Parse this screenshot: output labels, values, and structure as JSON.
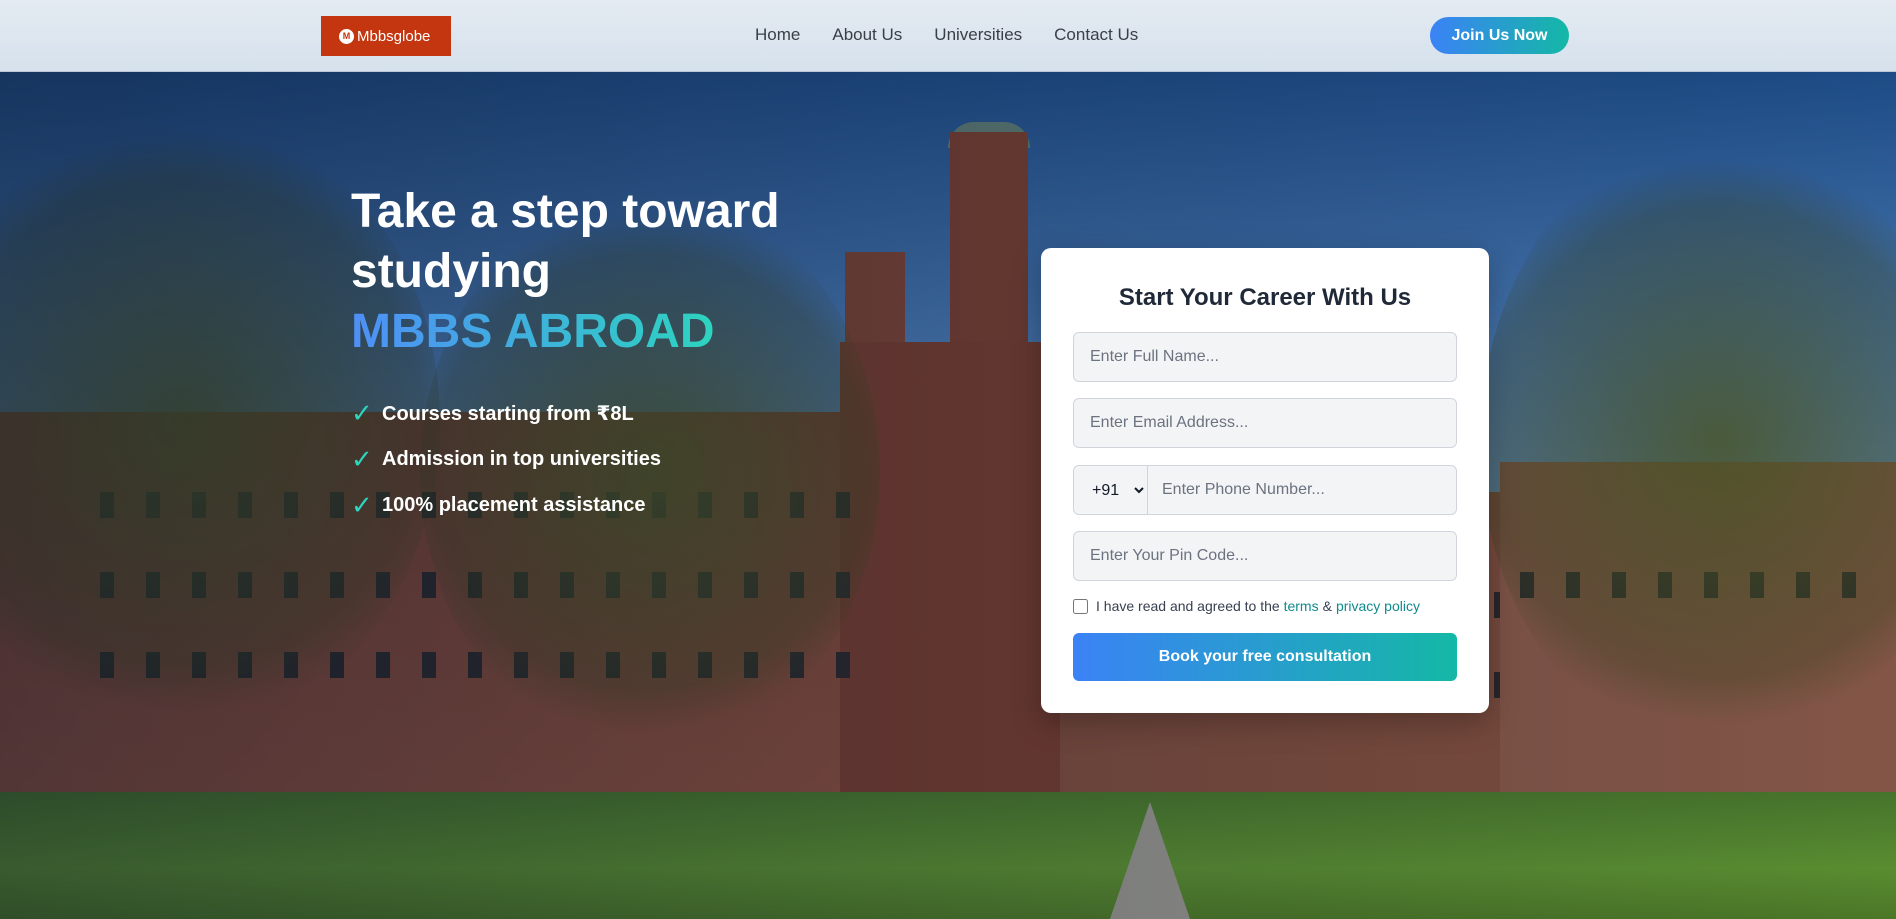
{
  "header": {
    "logo_text": "Mbbsglobe",
    "logo_mark": "M",
    "nav": [
      {
        "label": "Home"
      },
      {
        "label": "About Us"
      },
      {
        "label": "Universities"
      },
      {
        "label": "Contact Us"
      }
    ],
    "cta_label": "Join Us Now"
  },
  "hero": {
    "title_line1": "Take a step toward",
    "title_line2": "studying",
    "title_accent": "MBBS ABROAD",
    "features": [
      {
        "icon": "check-icon",
        "text": "Courses starting from ₹8L"
      },
      {
        "icon": "check-icon",
        "text": "Admission in top universities"
      },
      {
        "icon": "check-icon",
        "text": "100% placement assistance"
      }
    ]
  },
  "form": {
    "title": "Start Your Career With Us",
    "name_placeholder": "Enter Full Name...",
    "email_placeholder": "Enter Email Address...",
    "country_code": "+91",
    "phone_placeholder": "Enter Phone Number...",
    "pin_placeholder": "Enter Your Pin Code...",
    "agree_prefix": "I have read and agreed to the",
    "terms_label": "terms",
    "amp": "&",
    "privacy_label": "privacy policy",
    "submit_label": "Book your free consultation"
  },
  "colors": {
    "brand": "#c4360f",
    "accent_start": "#3b82f6",
    "accent_end": "#14b8a6"
  }
}
